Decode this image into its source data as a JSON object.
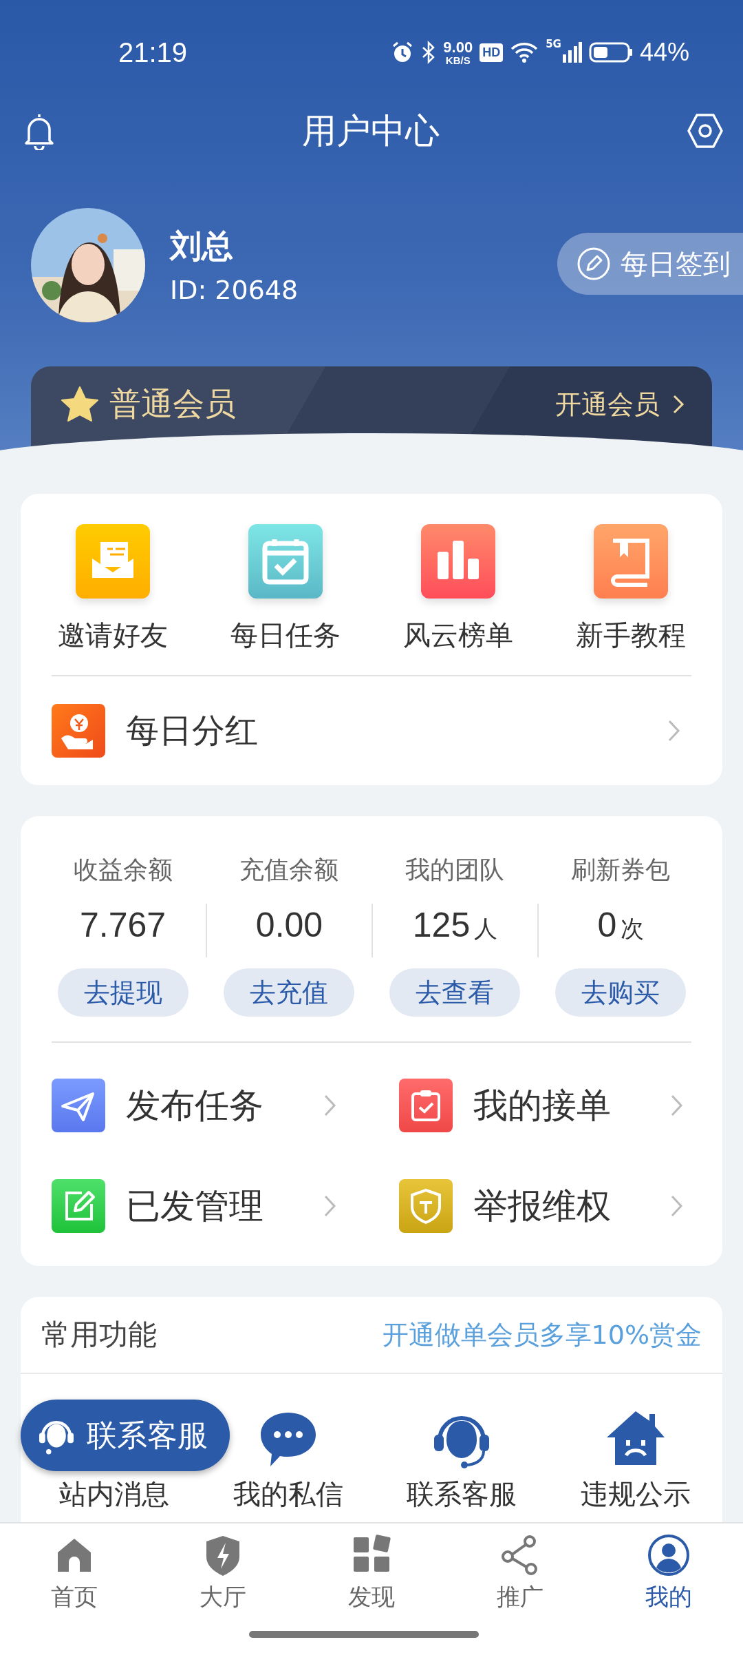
{
  "status_bar": {
    "time": "21:19",
    "net_speed": "9.00",
    "net_unit": "KB/S",
    "hd": "HD",
    "network": "5G",
    "battery": "44%"
  },
  "header": {
    "title": "用户中心"
  },
  "profile": {
    "name": "刘总",
    "id": "ID: 20648",
    "sign_in": "每日签到"
  },
  "membership": {
    "tier": "普通会员",
    "action": "开通会员"
  },
  "shortcuts": [
    {
      "label": "邀请好友",
      "kind": "invite"
    },
    {
      "label": "每日任务",
      "kind": "task"
    },
    {
      "label": "风云榜单",
      "kind": "rank"
    },
    {
      "label": "新手教程",
      "kind": "guide"
    }
  ],
  "dividend": {
    "label": "每日分红"
  },
  "balances": [
    {
      "label": "收益余额",
      "value": "7.767",
      "action": "去提现"
    },
    {
      "label": "充值余额",
      "value": "0.00",
      "action": "去充值"
    },
    {
      "label": "我的团队",
      "value": "125",
      "unit": "人",
      "action": "去查看"
    },
    {
      "label": "刷新券包",
      "value": "0",
      "unit": "次",
      "action": "去购买"
    }
  ],
  "links": [
    {
      "label": "发布任务",
      "kind": "publish"
    },
    {
      "label": "我的接单",
      "kind": "orders"
    },
    {
      "label": "已发管理",
      "kind": "manage"
    },
    {
      "label": "举报维权",
      "kind": "report"
    }
  ],
  "common": {
    "title": "常用功能",
    "promo": "开通做单会员多享10%赏金",
    "items": [
      {
        "label": "站内消息",
        "kind": "notice"
      },
      {
        "label": "我的私信",
        "kind": "chat"
      },
      {
        "label": "联系客服",
        "kind": "support"
      },
      {
        "label": "违规公示",
        "kind": "violation"
      }
    ]
  },
  "floating_button": {
    "label": "联系客服"
  },
  "tabs": [
    {
      "label": "首页",
      "kind": "home",
      "selected": false
    },
    {
      "label": "大厅",
      "kind": "hall",
      "selected": false
    },
    {
      "label": "发现",
      "kind": "discover",
      "selected": false
    },
    {
      "label": "推广",
      "kind": "share",
      "selected": false
    },
    {
      "label": "我的",
      "kind": "me",
      "selected": true
    }
  ]
}
